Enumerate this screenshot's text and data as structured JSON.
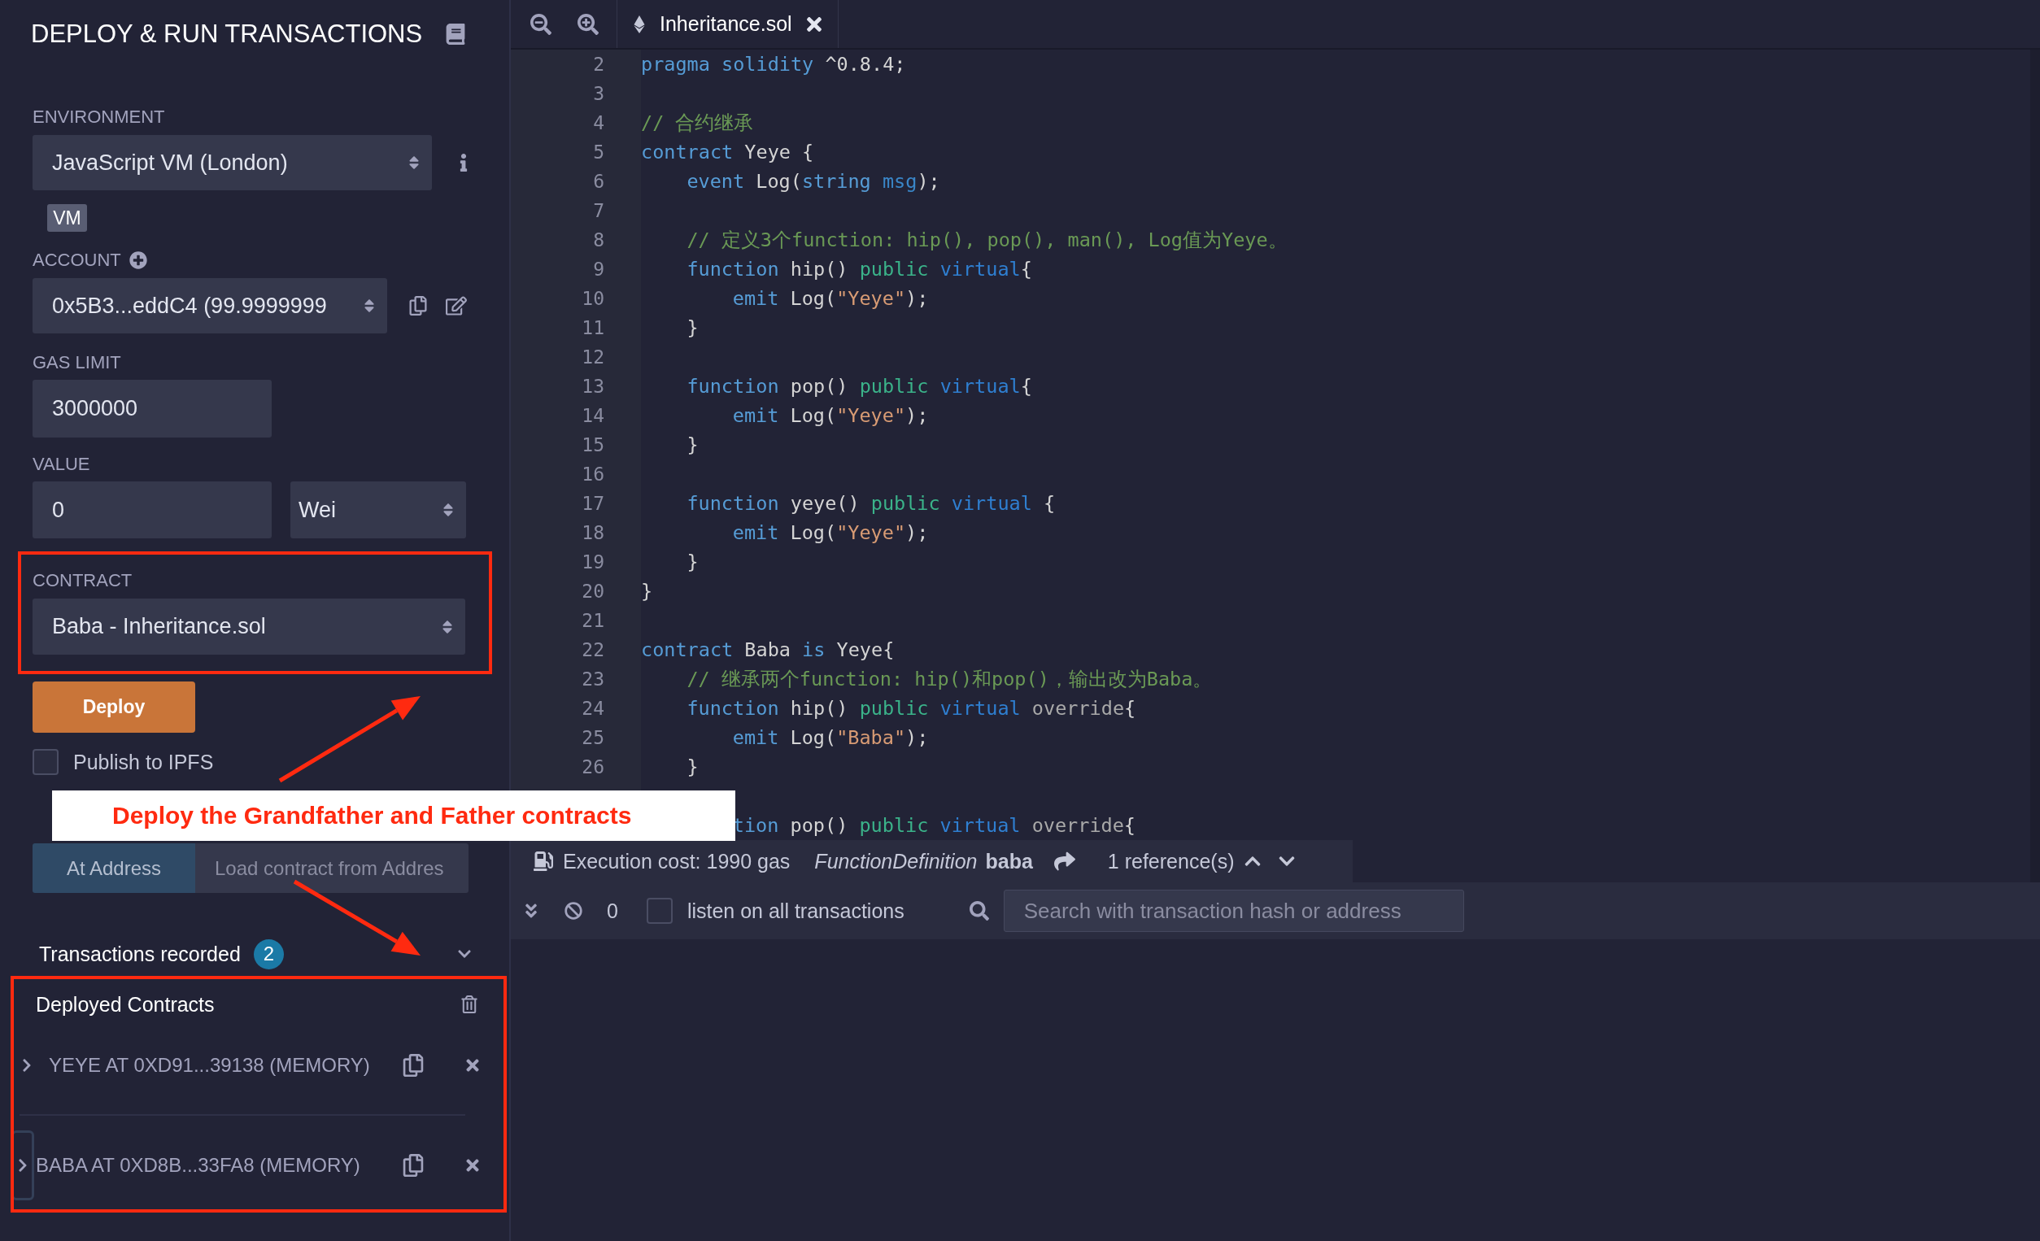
{
  "panel": {
    "title": "DEPLOY & RUN TRANSACTIONS",
    "environment": {
      "label": "ENVIRONMENT",
      "value": "JavaScript VM (London)",
      "badge": "VM"
    },
    "account": {
      "label": "ACCOUNT",
      "value": "0x5B3...eddC4 (99.9999999"
    },
    "gas_limit": {
      "label": "GAS LIMIT",
      "value": "3000000"
    },
    "value": {
      "label": "VALUE",
      "value": "0",
      "unit": "Wei"
    },
    "contract": {
      "label": "CONTRACT",
      "value": "Baba - Inheritance.sol"
    },
    "deploy_button": "Deploy",
    "publish": {
      "label": "Publish to IPFS",
      "checked": false
    },
    "at_address": {
      "button": "At Address",
      "placeholder": "Load contract from Addres"
    },
    "transactions": {
      "label": "Transactions recorded",
      "count": "2",
      "expanded": true
    },
    "deployed": {
      "title": "Deployed Contracts",
      "items": [
        {
          "label": "YEYE AT 0XD91...39138 (MEMORY)",
          "expanded": false,
          "focused": false
        },
        {
          "label": "BABA AT 0XD8B...33FA8 (MEMORY)",
          "expanded": false,
          "focused": true
        }
      ]
    }
  },
  "editor": {
    "tabs": [
      {
        "title": "Inheritance.sol",
        "selected": true
      }
    ],
    "lines": [
      {
        "kind": "numbered",
        "number": "2",
        "tokens": [
          {
            "kind": "kw",
            "t": "pragma "
          },
          {
            "kind": "kw",
            "t": "solidity "
          },
          {
            "kind": "plain",
            "t": "^0.8.4;"
          }
        ]
      },
      {
        "kind": "numbered",
        "number": "3"
      },
      {
        "kind": "numbered",
        "number": "4",
        "tokens": [
          {
            "kind": "com",
            "t": "// 合约继承"
          }
        ]
      },
      {
        "kind": "numbered",
        "number": "5",
        "tokens": [
          {
            "kind": "kw",
            "t": "contract "
          },
          {
            "kind": "plain",
            "t": "Yeye {"
          }
        ]
      },
      {
        "kind": "numbered",
        "number": "6",
        "tokens": [
          {
            "kind": "kw",
            "t": "    event "
          },
          {
            "kind": "plain",
            "t": "Log("
          },
          {
            "kind": "kw",
            "t": "string "
          },
          {
            "kind": "param",
            "t": "msg"
          },
          {
            "kind": "plain",
            "t": ");"
          }
        ]
      },
      {
        "kind": "numbered",
        "number": "7"
      },
      {
        "kind": "numbered",
        "number": "8",
        "tokens": [
          {
            "kind": "com",
            "t": "    // 定义3个function: hip(), pop(), man(), Log值为Yeye。"
          }
        ]
      },
      {
        "kind": "numbered",
        "number": "9",
        "tokens": [
          {
            "kind": "kw",
            "t": "    function "
          },
          {
            "kind": "plain",
            "t": "hip() "
          },
          {
            "kind": "vis",
            "t": "public "
          },
          {
            "kind": "mod",
            "t": "virtual"
          },
          {
            "kind": "plain",
            "t": "{"
          }
        ]
      },
      {
        "kind": "numbered",
        "number": "10",
        "tokens": [
          {
            "kind": "kw",
            "t": "        emit "
          },
          {
            "kind": "plain",
            "t": "Log("
          },
          {
            "kind": "str",
            "t": "\"Yeye\""
          },
          {
            "kind": "plain",
            "t": ");"
          }
        ]
      },
      {
        "kind": "numbered",
        "number": "11",
        "tokens": [
          {
            "kind": "plain",
            "t": "    }"
          }
        ]
      },
      {
        "kind": "numbered",
        "number": "12"
      },
      {
        "kind": "numbered",
        "number": "13",
        "tokens": [
          {
            "kind": "kw",
            "t": "    function "
          },
          {
            "kind": "plain",
            "t": "pop() "
          },
          {
            "kind": "vis",
            "t": "public "
          },
          {
            "kind": "mod",
            "t": "virtual"
          },
          {
            "kind": "plain",
            "t": "{"
          }
        ]
      },
      {
        "kind": "numbered",
        "number": "14",
        "tokens": [
          {
            "kind": "kw",
            "t": "        emit "
          },
          {
            "kind": "plain",
            "t": "Log("
          },
          {
            "kind": "str",
            "t": "\"Yeye\""
          },
          {
            "kind": "plain",
            "t": ");"
          }
        ]
      },
      {
        "kind": "numbered",
        "number": "15",
        "tokens": [
          {
            "kind": "plain",
            "t": "    }"
          }
        ]
      },
      {
        "kind": "numbered",
        "number": "16"
      },
      {
        "kind": "numbered",
        "number": "17",
        "tokens": [
          {
            "kind": "kw",
            "t": "    function "
          },
          {
            "kind": "plain",
            "t": "yeye() "
          },
          {
            "kind": "vis",
            "t": "public "
          },
          {
            "kind": "mod",
            "t": "virtual "
          },
          {
            "kind": "plain",
            "t": "{"
          }
        ]
      },
      {
        "kind": "numbered",
        "number": "18",
        "tokens": [
          {
            "kind": "kw",
            "t": "        emit "
          },
          {
            "kind": "plain",
            "t": "Log("
          },
          {
            "kind": "str",
            "t": "\"Yeye\""
          },
          {
            "kind": "plain",
            "t": ");"
          }
        ]
      },
      {
        "kind": "numbered",
        "number": "19",
        "tokens": [
          {
            "kind": "plain",
            "t": "    }"
          }
        ]
      },
      {
        "kind": "numbered",
        "number": "20",
        "tokens": [
          {
            "kind": "plain",
            "t": "}"
          }
        ]
      },
      {
        "kind": "numbered",
        "number": "21"
      },
      {
        "kind": "numbered",
        "number": "22",
        "tokens": [
          {
            "kind": "kw",
            "t": "contract "
          },
          {
            "kind": "plain",
            "t": "Baba "
          },
          {
            "kind": "kw",
            "t": "is "
          },
          {
            "kind": "plain",
            "t": "Yeye{"
          }
        ]
      },
      {
        "kind": "numbered",
        "number": "23",
        "tokens": [
          {
            "kind": "com",
            "t": "    // 继承两个function: hip()和pop()，输出改为Baba。"
          }
        ]
      },
      {
        "kind": "numbered",
        "number": "24",
        "tokens": [
          {
            "kind": "kw",
            "t": "    function "
          },
          {
            "kind": "plain",
            "t": "hip() "
          },
          {
            "kind": "vis",
            "t": "public "
          },
          {
            "kind": "mod",
            "t": "virtual "
          },
          {
            "kind": "ovr",
            "t": "override"
          },
          {
            "kind": "plain",
            "t": "{"
          }
        ]
      },
      {
        "kind": "numbered",
        "number": "25",
        "tokens": [
          {
            "kind": "kw",
            "t": "        emit "
          },
          {
            "kind": "plain",
            "t": "Log("
          },
          {
            "kind": "str",
            "t": "\"Baba\""
          },
          {
            "kind": "plain",
            "t": ");"
          }
        ]
      },
      {
        "kind": "numbered",
        "number": "26",
        "tokens": [
          {
            "kind": "plain",
            "t": "    }"
          }
        ]
      },
      {
        "kind": "covered"
      },
      {
        "kind": "covered",
        "tokens": [
          {
            "kind": "kw",
            "t": "        tion "
          },
          {
            "kind": "plain",
            "t": "pop() "
          },
          {
            "kind": "vis",
            "t": "public "
          },
          {
            "kind": "mod",
            "t": "virtual "
          },
          {
            "kind": "ovr",
            "t": "override"
          },
          {
            "kind": "plain",
            "t": "{"
          }
        ]
      }
    ],
    "status": {
      "cost": "Execution cost: 1990 gas",
      "node_kind": "FunctionDefinition",
      "node_name": "baba",
      "references": "1 reference(s)"
    }
  },
  "terminal": {
    "count": "0",
    "listen": {
      "label": "listen on all transactions",
      "checked": false
    },
    "search_placeholder": "Search with transaction hash or address"
  },
  "annotation": {
    "callout": "Deploy the Grandfather and Father contracts"
  }
}
